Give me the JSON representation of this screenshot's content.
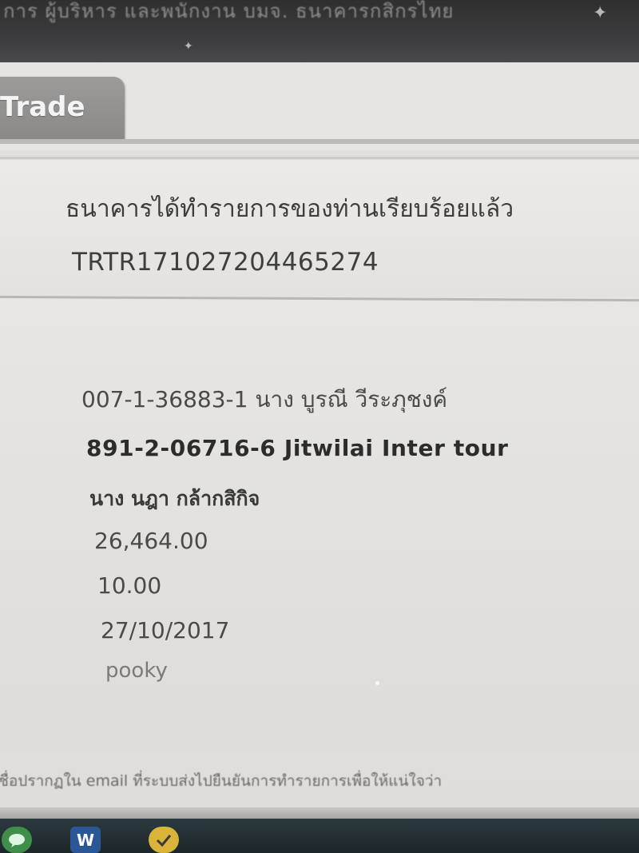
{
  "header": {
    "banner_text": "การ ผู้บริหาร และพนักงาน บมจ. ธนาคารกสิกรไทย"
  },
  "tabs": {
    "active_tab_label": "Trade"
  },
  "confirmation": {
    "message": "ธนาคารได้ทำรายการของท่านเรียบร้อยแล้ว",
    "reference_number": "TRTR171027204465274"
  },
  "transaction": {
    "from_account": "007-1-36883-1 นาง บูรณี วีระภุชงค์",
    "to_account": "891-2-06716-6 Jitwilai Inter tour",
    "recipient_name": "นาง นฎา กล้ากสิกิจ",
    "amount": "26,464.00",
    "fee": "10.00",
    "date": "27/10/2017",
    "memo": "pooky"
  },
  "footer": {
    "note": "ชื่อปรากฏใน email ที่ระบบส่งไปยืนยันการทำรายการเพื่อให้แน่ใจว่า"
  },
  "taskbar": {
    "word_icon_label": "W"
  },
  "colors": {
    "tab_background": "#8a8987",
    "taskbar_background": "#1d2629",
    "page_background": "#e7e5e2"
  }
}
